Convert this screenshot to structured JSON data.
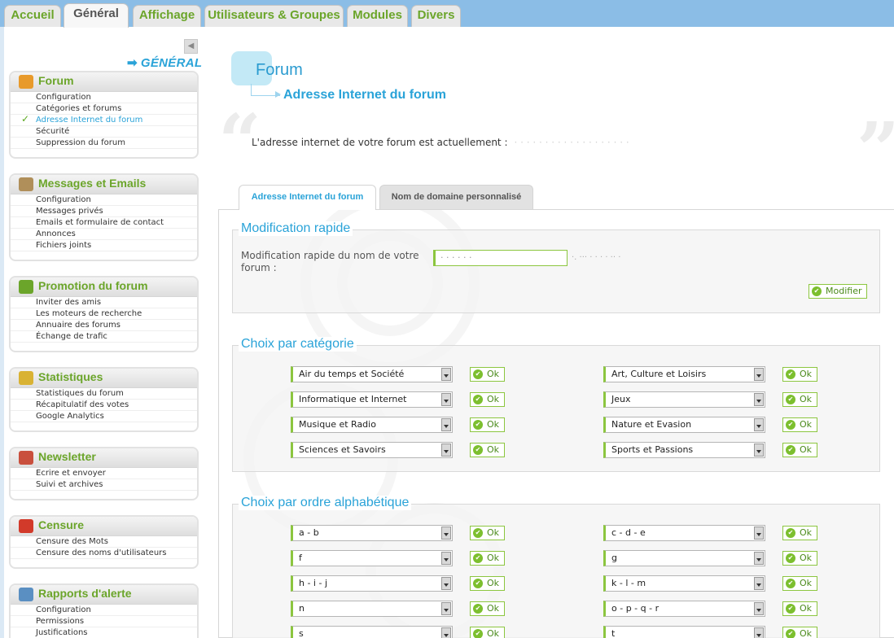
{
  "top_tabs": [
    {
      "label": "Accueil",
      "active": false
    },
    {
      "label": "Général",
      "active": true
    },
    {
      "label": "Affichage",
      "active": false
    },
    {
      "label": "Utilisateurs & Groupes",
      "active": false
    },
    {
      "label": "Modules",
      "active": false
    },
    {
      "label": "Divers",
      "active": false
    }
  ],
  "sidebar": {
    "collapse_glyph": "◀",
    "heading_arrow": "➡",
    "heading": "GÉNÉRAL",
    "sections": [
      {
        "title": "Forum",
        "icon": "wrench-icon",
        "icon_color": "#e89a2b",
        "items": [
          "Configuration",
          "Catégories et forums",
          "Adresse Internet du forum",
          "Sécurité",
          "Suppression du forum"
        ],
        "current": 2
      },
      {
        "title": "Messages et Emails",
        "icon": "envelope-icon",
        "icon_color": "#b08f5a",
        "items": [
          "Configuration",
          "Messages privés",
          "Emails et formulaire de contact",
          "Annonces",
          "Fichiers joints"
        ],
        "current": -1
      },
      {
        "title": "Promotion du forum",
        "icon": "megaphone-icon",
        "icon_color": "#6ba52a",
        "items": [
          "Inviter des amis",
          "Les moteurs de recherche",
          "Annuaire des forums",
          "Échange de trafic"
        ],
        "current": -1
      },
      {
        "title": "Statistiques",
        "icon": "pie-chart-icon",
        "icon_color": "#d9b233",
        "items": [
          "Statistiques du forum",
          "Récapitulatif des votes",
          "Google Analytics"
        ],
        "current": -1
      },
      {
        "title": "Newsletter",
        "icon": "newsletter-icon",
        "icon_color": "#c94f3d",
        "items": [
          "Ecrire et envoyer",
          "Suivi et archives"
        ],
        "current": -1
      },
      {
        "title": "Censure",
        "icon": "forbidden-icon",
        "icon_color": "#d23a2a",
        "items": [
          "Censure des Mots",
          "Censure des noms d'utilisateurs"
        ],
        "current": -1
      },
      {
        "title": "Rapports d'alerte",
        "icon": "alert-report-icon",
        "icon_color": "#5a8fc2",
        "items": [
          "Configuration",
          "Permissions",
          "Justifications"
        ],
        "current": -1
      }
    ]
  },
  "content": {
    "title": "Forum",
    "subtitle": "Adresse Internet du forum",
    "open_quote": "“",
    "close_quote": "”",
    "address_text": "L'adresse internet de votre forum est actuellement :",
    "address_value": "· · ·  · · · · ·  · ·  · · · · · ·  · ·   ·",
    "tabs": [
      "Adresse Internet du forum",
      "Nom de domaine personnalisé"
    ],
    "quick_edit": {
      "legend": "Modification rapide",
      "label": "Modification rapide du nom de votre forum :",
      "input_value": "·  ·  ·   ·  ·  ·",
      "suffix": "·. ··· · · · ·  ·· ·",
      "button": "Modifier"
    },
    "by_category": {
      "legend": "Choix par catégorie",
      "options": [
        "Air du temps et Société",
        "Art, Culture et Loisirs",
        "Informatique et Internet",
        "Jeux",
        "Musique et Radio",
        "Nature et Evasion",
        "Sciences et Savoirs",
        "Sports et Passions"
      ]
    },
    "by_alpha": {
      "legend": "Choix par ordre alphabétique",
      "options": [
        "a - b",
        "c - d - e",
        "f",
        "g",
        "h - i - j",
        "k - l - m",
        "n",
        "o - p - q - r",
        "s",
        "t"
      ]
    },
    "ok_label": "Ok",
    "ok_glyph": "✔"
  },
  "colors": {
    "accent_blue": "#2aa3d8",
    "accent_green": "#6ba52a",
    "tab_bar": "#8bbde6"
  }
}
